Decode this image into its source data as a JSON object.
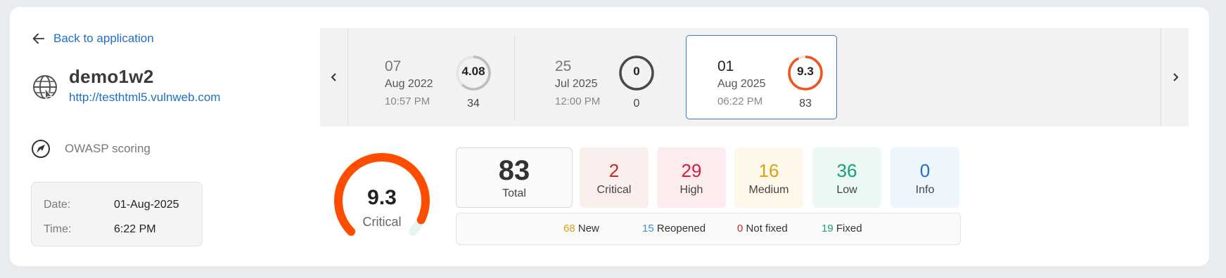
{
  "back_link": "Back to application",
  "app": {
    "name": "demo1w2",
    "url": "http://testhtml5.vulnweb.com"
  },
  "scoring": "OWASP scoring",
  "scan_info": {
    "date_label": "Date:",
    "date_value": "01-Aug-2025",
    "time_label": "Time:",
    "time_value": "6:22 PM"
  },
  "scans": [
    {
      "day": "07",
      "month": "Aug 2022",
      "time": "10:57 PM",
      "score": "4.08",
      "count": "34",
      "ring_color": "#bdbdbd",
      "ring_fraction": 0.62
    },
    {
      "day": "25",
      "month": "Jul 2025",
      "time": "12:00 PM",
      "score": "0",
      "count": "0",
      "ring_color": "#4a4a4a",
      "ring_fraction": 1.0
    },
    {
      "day": "01",
      "month": "Aug 2025",
      "time": "06:22 PM",
      "score": "9.3",
      "count": "83",
      "ring_color": "#f0541e",
      "ring_fraction": 0.93,
      "selected": true
    }
  ],
  "score": {
    "value": "9.3",
    "label": "Critical",
    "fraction": 0.93,
    "color": "#ff4d00"
  },
  "stats": {
    "total": {
      "value": "83",
      "label": "Total"
    },
    "critical": {
      "value": "2",
      "label": "Critical",
      "color": "#c62828",
      "bg": "#fbefed"
    },
    "high": {
      "value": "29",
      "label": "High",
      "color": "#d81b3c",
      "bg": "#fdeced"
    },
    "medium": {
      "value": "16",
      "label": "Medium",
      "color": "#d9a11a",
      "bg": "#fdf8ea"
    },
    "low": {
      "value": "36",
      "label": "Low",
      "color": "#18a07a",
      "bg": "#ebf8f3"
    },
    "info": {
      "value": "0",
      "label": "Info",
      "color": "#1f6fc5",
      "bg": "#eef6fd"
    }
  },
  "status": {
    "new": {
      "value": "68",
      "label": "New",
      "color": "#d9a11a"
    },
    "reopened": {
      "value": "15",
      "label": "Reopened",
      "color": "#3d8fd6"
    },
    "not_fixed": {
      "value": "0",
      "label": "Not fixed",
      "color": "#c62828"
    },
    "fixed": {
      "value": "19",
      "label": "Fixed",
      "color": "#18a07a"
    }
  }
}
